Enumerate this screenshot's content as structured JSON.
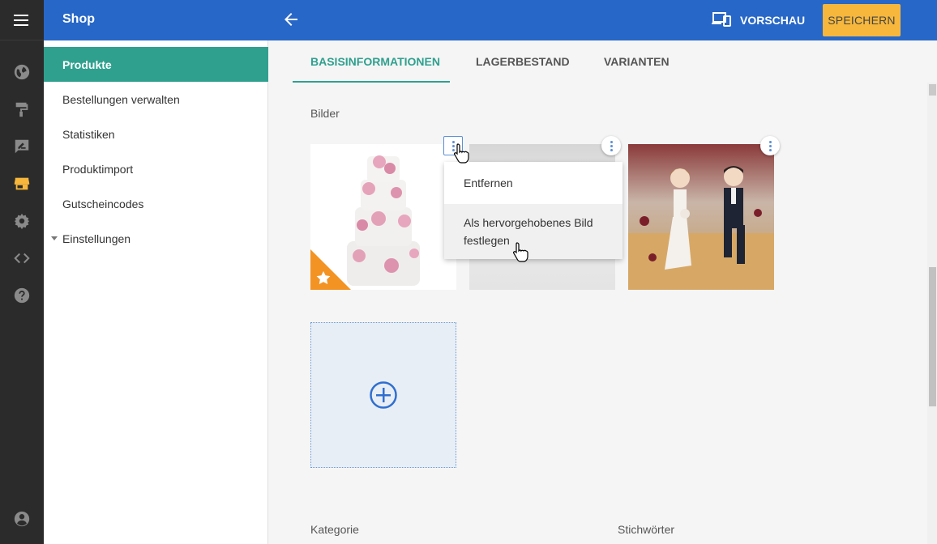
{
  "app": {
    "title": "Shop"
  },
  "rail": {
    "icons": [
      "menu-icon",
      "globe-icon",
      "paint-roller-icon",
      "edit-note-icon",
      "store-icon",
      "gear-icon",
      "code-icon",
      "help-icon",
      "account-icon"
    ]
  },
  "header": {
    "preview_label": "VORSCHAU",
    "save_label": "SPEICHERN"
  },
  "sidebar": {
    "items": [
      {
        "label": "Produkte",
        "active": true
      },
      {
        "label": "Bestellungen verwalten"
      },
      {
        "label": "Statistiken"
      },
      {
        "label": "Produktimport"
      },
      {
        "label": "Gutscheincodes"
      },
      {
        "label": "Einstellungen",
        "expandable": true
      }
    ]
  },
  "tabs": [
    {
      "label": "BASISINFORMATIONEN",
      "active": true
    },
    {
      "label": "LAGERBESTAND"
    },
    {
      "label": "VARIANTEN"
    }
  ],
  "images_section": {
    "label": "Bilder",
    "context_menu": {
      "items": [
        "Entfernen",
        "Als hervorgehobenes Bild festlegen"
      ]
    }
  },
  "fields": {
    "category_label": "Kategorie",
    "tags_label": "Stichwörter"
  },
  "colors": {
    "topbar": "#2767c8",
    "accent": "#2fa08e",
    "save": "#f6b73c",
    "rail": "#2b2b2b",
    "featured_badge": "#f39323"
  }
}
